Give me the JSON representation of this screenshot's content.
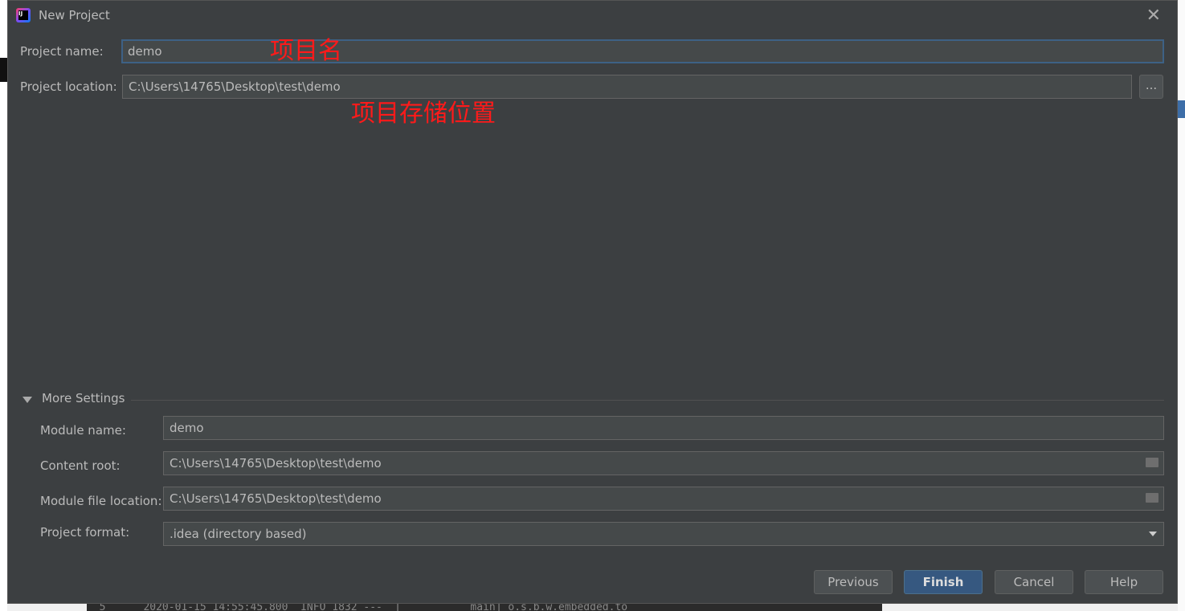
{
  "dialog": {
    "title": "New Project",
    "close_icon": "close-icon"
  },
  "form": {
    "project_name_label": "Project name:",
    "project_name_value": "demo",
    "project_location_label": "Project location:",
    "project_location_value": "C:\\Users\\14765\\Desktop\\test\\demo",
    "browse_label": "..."
  },
  "annotations": {
    "name_note": "项目名",
    "location_note": "项目存储位置",
    "color": "#ff1a1a"
  },
  "more_settings": {
    "title": "More Settings",
    "expanded": true,
    "module_name_label": "Module name:",
    "module_name_value": "demo",
    "content_root_label": "Content root:",
    "content_root_value": "C:\\Users\\14765\\Desktop\\test\\demo",
    "module_file_location_label": "Module file location:",
    "module_file_location_value": "C:\\Users\\14765\\Desktop\\test\\demo",
    "project_format_label": "Project format:",
    "project_format_value": ".idea (directory based)"
  },
  "buttons": {
    "previous": "Previous",
    "finish": "Finish",
    "cancel": "Cancel",
    "help": "Help"
  },
  "background": {
    "terminal_line": "  5      2020-01-15 14:55:45.800  INFO 1832 ---  [           main] o.s.b.w.embedded.to"
  },
  "colors": {
    "dialog_bg": "#3c3f41",
    "primary_button": "#365880",
    "focus_border": "#3d6185"
  }
}
